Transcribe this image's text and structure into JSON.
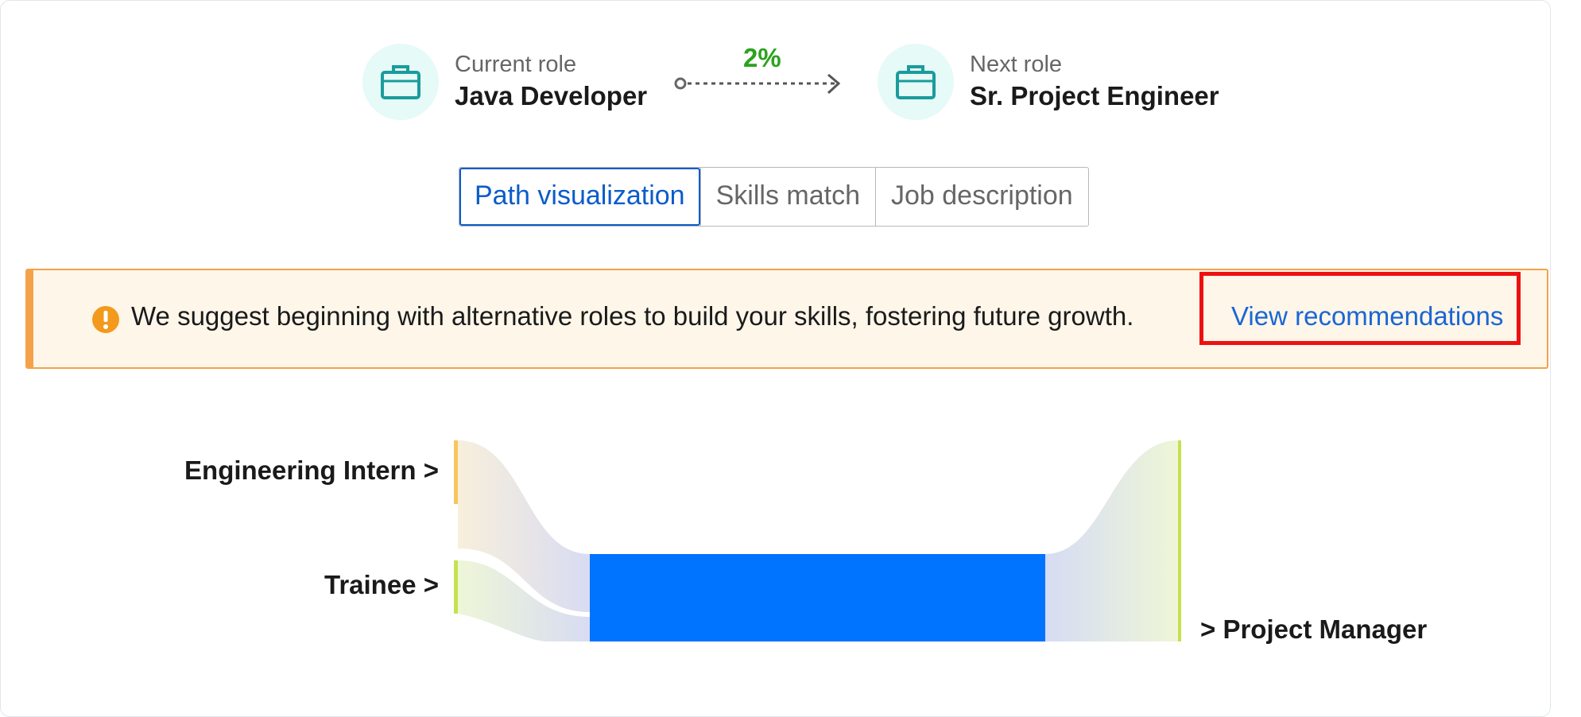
{
  "current_role": {
    "caption": "Current role",
    "title": "Java Developer"
  },
  "next_role": {
    "caption": "Next role",
    "title": "Sr. Project Engineer"
  },
  "match_percent": "2%",
  "tabs": [
    {
      "label": "Path visualization",
      "active": true
    },
    {
      "label": "Skills match",
      "active": false
    },
    {
      "label": "Job description",
      "active": false
    }
  ],
  "banner": {
    "message": "We suggest beginning with alternative roles to build your skills, fostering future growth.",
    "link_label": "View recommendations"
  },
  "path": {
    "left_nodes": [
      {
        "label": "Engineering Intern >",
        "color": "#f7c65a"
      },
      {
        "label": "Trainee >",
        "color": "#c5e14f"
      }
    ],
    "center_color": "#0073ff",
    "right_nodes": [
      {
        "label": "> Project Manager",
        "color": "#c5e14f"
      }
    ]
  },
  "colors": {
    "accent": "#0b5cc9",
    "success": "#2aa31c",
    "warning": "#f4a24a",
    "icon_teal": "#1a9c9c"
  }
}
